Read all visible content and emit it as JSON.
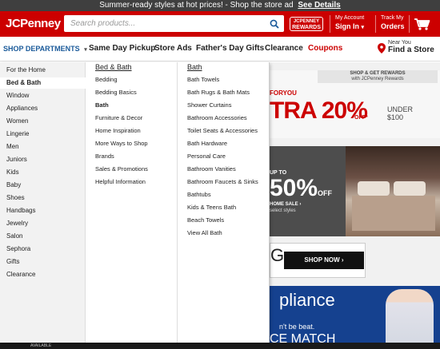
{
  "promo": {
    "text": "Summer-ready styles at hot prices!  - Shop the store ad",
    "link": "See Details"
  },
  "header": {
    "logo": "JCPenney",
    "search_placeholder": "Search products...",
    "rewards_line1": "JCPENNEY",
    "rewards_line2": "REWARDS",
    "account_small": "My Account",
    "account_big": "Sign In",
    "track_small": "Track My",
    "track_big": "Orders"
  },
  "nav": {
    "shop_departments": "SHOP DEPARTMENTS",
    "items": [
      "Same Day Pickup",
      "Store Ads",
      "Father's Day Gifts",
      "Clearance",
      "Coupons"
    ],
    "near_small": "Near You",
    "near_big": "Find a Store"
  },
  "categories": [
    "For the Home",
    "Bed & Bath",
    "Window",
    "Appliances",
    "Women",
    "Lingerie",
    "Men",
    "Juniors",
    "Kids",
    "Baby",
    "Shoes",
    "Handbags",
    "Jewelry",
    "Salon",
    "Sephora",
    "Gifts",
    "Clearance"
  ],
  "active_category": "Bed & Bath",
  "bed_bath_column": {
    "heading": "Bed & Bath",
    "items": [
      "Bedding",
      "Bedding Basics",
      "Bath",
      "Furniture & Decor",
      "Home Inspiration",
      "More Ways to Shop",
      "Brands",
      "Sales & Promotions",
      "Helpful Information"
    ],
    "active": "Bath"
  },
  "bath_column": {
    "heading": "Bath",
    "items": [
      "Bath Towels",
      "Bath Rugs & Bath Mats",
      "Shower Curtains",
      "Bathroom Accessories",
      "Toilet Seats & Accessories",
      "Bath Hardware",
      "Personal Care",
      "Bathroom Vanities",
      "Bathroom Faucets & Sinks",
      "Bathtubs",
      "Kids & Teens Bath",
      "Beach Towels",
      "View All Bath"
    ]
  },
  "background": {
    "banner1_strip_line1": "SHOP & GET REWARDS",
    "banner1_strip_line2": "with JCPenney Rewards",
    "banner1_foryou": "FORYOU",
    "banner1_big": "TRA 20%",
    "banner1_off": "OFF*",
    "banner1_under": "UNDER",
    "banner1_amount": "$100",
    "banner2_upto": "UP TO",
    "banner2_big": "50%",
    "banner2_off": "OFF",
    "banner2_sale": "HOME SALE ›",
    "banner2_select": "select styles",
    "banner3_partial": "G",
    "shop_now": "SHOP NOW ›",
    "appliance_word": "pliance",
    "appliance_beat": "n't be beat.",
    "appliance_match": "CE MATCH",
    "bottom_strip": "AVAILABLE"
  },
  "colors": {
    "brand_red": "#cc0000",
    "nav_blue": "#1a5a9a",
    "promo_bar": "#3f3f3f"
  }
}
